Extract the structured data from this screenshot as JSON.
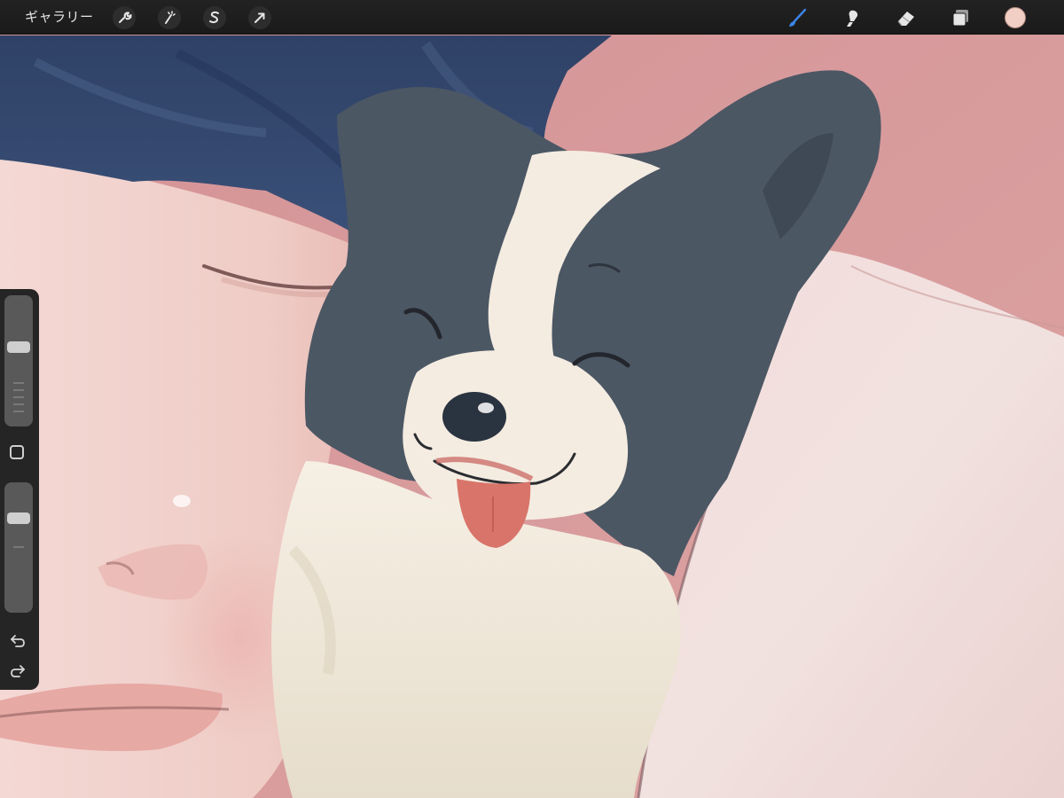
{
  "toolbar": {
    "gallery_label": "ギャラリー",
    "left_tools": [
      {
        "name": "actions-icon"
      },
      {
        "name": "adjustments-icon"
      },
      {
        "name": "selection-icon"
      },
      {
        "name": "transform-icon"
      }
    ],
    "right_tools": [
      {
        "name": "brush-icon",
        "active": true
      },
      {
        "name": "smudge-icon",
        "active": false
      },
      {
        "name": "eraser-icon",
        "active": false
      },
      {
        "name": "layers-icon",
        "active": false
      }
    ],
    "current_color": "#f1cfc4",
    "active_tool_color": "#3a86e8"
  },
  "sidebar": {
    "brush_size_level": 0.38,
    "opacity_level": 0.24,
    "modify_button": "square-icon",
    "undo": "undo-icon",
    "redo": "redo-icon"
  },
  "canvas": {
    "subject": "painting",
    "palette": {
      "background": "#d89a9c",
      "hair": "#34466a",
      "skin": "#f1d2cd",
      "dog_dark": "#4c5764",
      "dog_light": "#f4ece1",
      "pillow": "#f2dcda",
      "tongue": "#d9746a"
    }
  }
}
